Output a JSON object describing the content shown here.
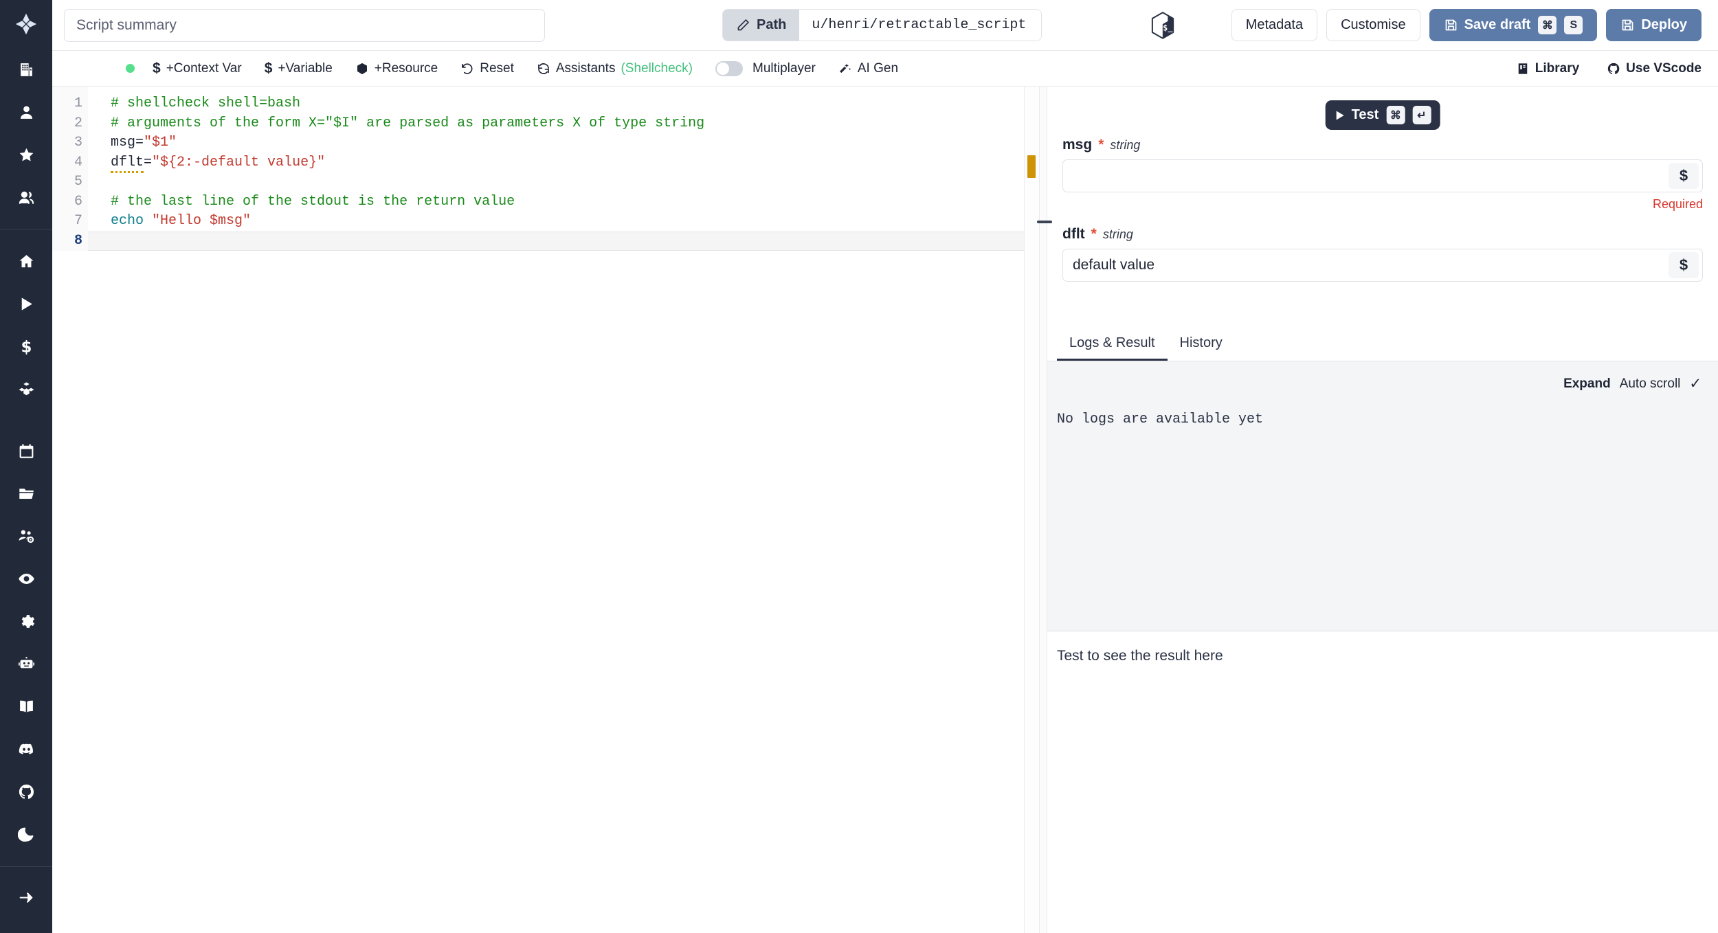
{
  "app": {
    "logo_icon": "windmill-logo-icon"
  },
  "sidebar": {
    "top_items": [
      {
        "icon": "building-icon",
        "name": "sidebar-item-workspace"
      },
      {
        "icon": "user-icon",
        "name": "sidebar-item-user"
      },
      {
        "icon": "star-icon",
        "name": "sidebar-item-favorites"
      },
      {
        "icon": "users-icon",
        "name": "sidebar-item-groups"
      }
    ],
    "nav_items": [
      {
        "icon": "home-icon",
        "name": "sidebar-item-home"
      },
      {
        "icon": "play-icon",
        "name": "sidebar-item-runs"
      },
      {
        "icon": "dollar-icon",
        "name": "sidebar-item-variables"
      },
      {
        "icon": "boxes-icon",
        "name": "sidebar-item-resources"
      }
    ],
    "tool_items": [
      {
        "icon": "calendar-icon",
        "name": "sidebar-item-schedules"
      },
      {
        "icon": "folder-icon",
        "name": "sidebar-item-folders"
      },
      {
        "icon": "user-settings-icon",
        "name": "sidebar-item-workers"
      },
      {
        "icon": "eye-icon",
        "name": "sidebar-item-audit-logs"
      },
      {
        "icon": "gear-icon",
        "name": "sidebar-item-settings"
      },
      {
        "icon": "robot-icon",
        "name": "sidebar-item-ai"
      }
    ],
    "footer_items": [
      {
        "icon": "book-icon",
        "name": "sidebar-item-docs"
      },
      {
        "icon": "discord-icon",
        "name": "sidebar-item-discord"
      },
      {
        "icon": "github-icon",
        "name": "sidebar-item-github"
      },
      {
        "icon": "moon-icon",
        "name": "sidebar-item-dark-mode"
      }
    ],
    "collapse": {
      "icon": "arrow-right-icon",
      "name": "sidebar-collapse-toggle"
    }
  },
  "header": {
    "summary_placeholder": "Script summary",
    "summary_value": "",
    "path_label": "Path",
    "path_value": "u/henri/retractable_script",
    "lang_logo_icon": "bash-logo-icon",
    "metadata_label": "Metadata",
    "customise_label": "Customise",
    "save_draft_label": "Save draft",
    "save_draft_keys": [
      "⌘",
      "S"
    ],
    "deploy_label": "Deploy",
    "accent_color": "#5d7ba8"
  },
  "toolbar": {
    "status_dot_color": "#55e08d",
    "context_var_label": "+Context Var",
    "variable_label": "+Variable",
    "resource_label": "+Resource",
    "reset_label": "Reset",
    "assistants_label": "Assistants",
    "assistants_detail": "(Shellcheck)",
    "assistants_detail_color": "#44c07c",
    "multiplayer_label": "Multiplayer",
    "multiplayer_enabled": false,
    "ai_gen_label": "AI Gen",
    "library_label": "Library",
    "vscode_label": "Use VScode"
  },
  "editor": {
    "language": "bash",
    "active_line": 8,
    "lines": [
      {
        "n": 1,
        "text": "# shellcheck shell=bash"
      },
      {
        "n": 2,
        "text": "# arguments of the form X=\"$I\" are parsed as parameters X of type string"
      },
      {
        "n": 3,
        "text": "msg=\"$1\""
      },
      {
        "n": 4,
        "text": "dflt=\"${2:-default value}\""
      },
      {
        "n": 5,
        "text": ""
      },
      {
        "n": 6,
        "text": "# the last line of the stdout is the return value"
      },
      {
        "n": 7,
        "text": "echo \"Hello $msg\""
      },
      {
        "n": 8,
        "text": ""
      }
    ],
    "tokens": {
      "l1_comment": "# shellcheck shell=bash",
      "l2_comment": "# arguments of the form X=\"$I\" are parsed as parameters X of type string",
      "l3_name": "msg=",
      "l3_string": "\"$1\"",
      "l4_name": "dflt",
      "l4_eq": "=",
      "l4_string": "\"${2:-default value}\"",
      "l6_comment": "# the last line of the stdout is the return value",
      "l7_kw": "echo",
      "l7_string": "\"Hello $msg\""
    },
    "warning_marker_color": "#cf9406"
  },
  "test_button": {
    "label": "Test",
    "keys": [
      "⌘",
      "↵"
    ]
  },
  "args_form": {
    "fields": [
      {
        "name": "msg",
        "required": true,
        "type": "string",
        "value": "",
        "error": "Required",
        "suffix_icon": "dollar-icon"
      },
      {
        "name": "dflt",
        "required": true,
        "type": "string",
        "value": "default value",
        "error": "",
        "suffix_icon": "dollar-icon"
      }
    ],
    "required_marker": "*",
    "error_color": "#d9342b"
  },
  "result_panel": {
    "tabs": [
      {
        "label": "Logs & Result",
        "active": true
      },
      {
        "label": "History",
        "active": false
      }
    ],
    "expand_label": "Expand",
    "auto_scroll_label": "Auto scroll",
    "auto_scroll_checked": "✓",
    "logs_empty_text": "No logs are available yet",
    "result_empty_text": "Test to see the result here"
  }
}
